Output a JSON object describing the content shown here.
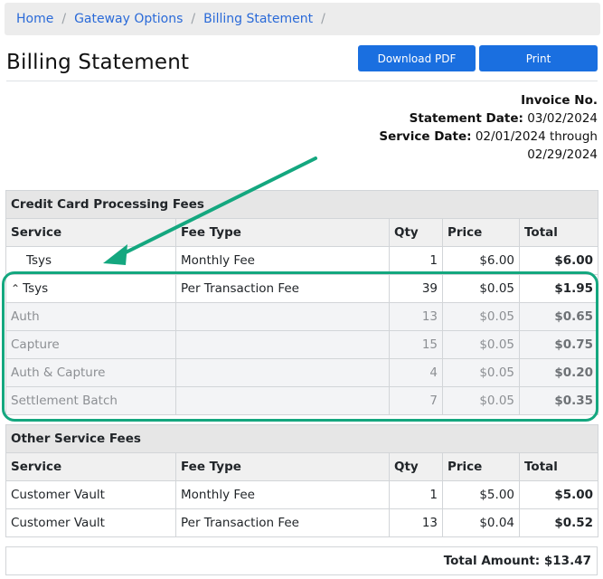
{
  "breadcrumb": {
    "items": [
      "Home",
      "Gateway Options",
      "Billing Statement"
    ],
    "separator": "/"
  },
  "page": {
    "title": "Billing Statement"
  },
  "toolbar": {
    "download_pdf_label": "Download PDF",
    "print_label": "Print"
  },
  "invoice": {
    "invoice_no_label": "Invoice No.",
    "statement_date_label": "Statement Date:",
    "statement_date": "03/02/2024",
    "service_date_label": "Service Date:",
    "service_date_line1": "02/01/2024 through",
    "service_date_line2": "02/29/2024"
  },
  "columns": {
    "service": "Service",
    "fee_type": "Fee Type",
    "qty": "Qty",
    "price": "Price",
    "total": "Total"
  },
  "cc_section": {
    "title": "Credit Card Processing Fees",
    "rows": [
      {
        "service": "Tsys",
        "fee_type": "Monthly Fee",
        "qty": "1",
        "price": "$6.00",
        "total": "$6.00"
      },
      {
        "service": "Tsys",
        "fee_type": "Per Transaction Fee",
        "qty": "39",
        "price": "$0.05",
        "total": "$1.95"
      }
    ],
    "subrows": [
      {
        "service": "Auth",
        "qty": "13",
        "price": "$0.05",
        "total": "$0.65"
      },
      {
        "service": "Capture",
        "qty": "15",
        "price": "$0.05",
        "total": "$0.75"
      },
      {
        "service": "Auth & Capture",
        "qty": "4",
        "price": "$0.05",
        "total": "$0.20"
      },
      {
        "service": "Settlement Batch",
        "qty": "7",
        "price": "$0.05",
        "total": "$0.35"
      }
    ]
  },
  "other_section": {
    "title": "Other Service Fees",
    "rows": [
      {
        "service": "Customer Vault",
        "fee_type": "Monthly Fee",
        "qty": "1",
        "price": "$5.00",
        "total": "$5.00"
      },
      {
        "service": "Customer Vault",
        "fee_type": "Per Transaction Fee",
        "qty": "13",
        "price": "$0.04",
        "total": "$0.52"
      }
    ]
  },
  "summary": {
    "total_label": "Total Amount:",
    "total_value": "$13.47"
  },
  "annotation": {
    "color": "#14a77f",
    "icon": "arrow-annotation"
  },
  "colors": {
    "accent": "#1a6fe0",
    "link": "#2a6ad8",
    "highlight": "#14a77f"
  }
}
